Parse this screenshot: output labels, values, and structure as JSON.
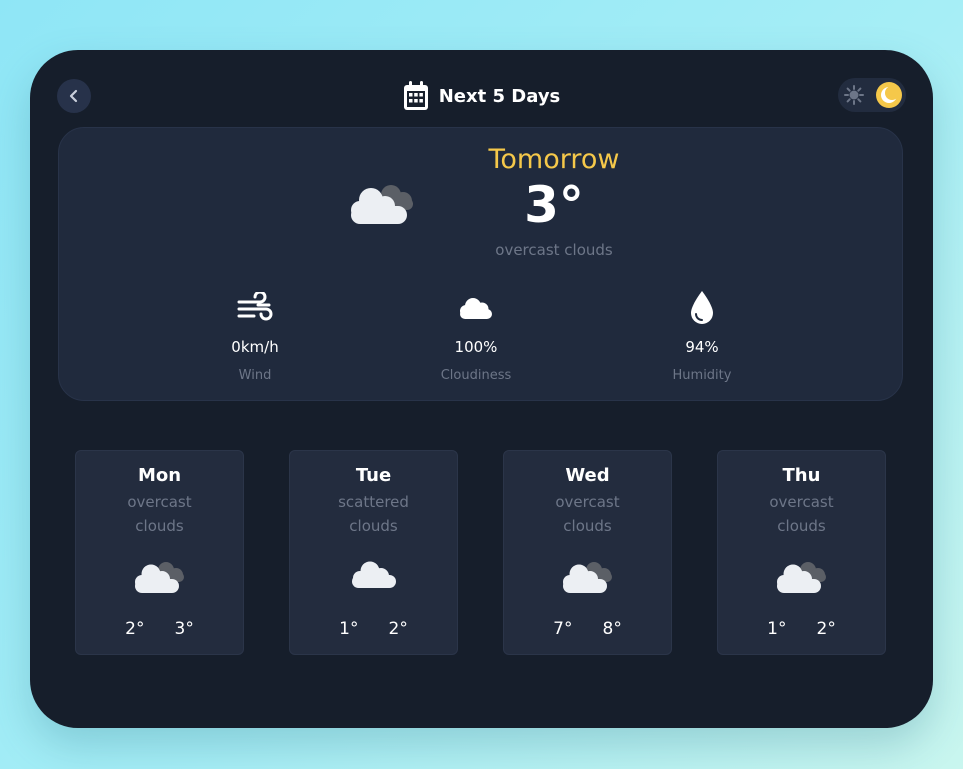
{
  "header": {
    "title": "Next 5 Days",
    "back_icon": "chevron-left-icon",
    "calendar_icon": "calendar-icon"
  },
  "theme_toggle": {
    "light_icon": "sun-icon",
    "dark_icon": "moon-icon",
    "active": "dark"
  },
  "hero": {
    "day": "Tomorrow",
    "temp": "3°",
    "description": "overcast clouds",
    "icon": "overcast-cloud-icon",
    "stats": [
      {
        "icon": "wind-icon",
        "value": "0km/h",
        "label": "Wind"
      },
      {
        "icon": "cloud-icon",
        "value": "100%",
        "label": "Cloudiness"
      },
      {
        "icon": "droplet-icon",
        "value": "94%",
        "label": "Humidity"
      }
    ]
  },
  "days": [
    {
      "name": "Mon",
      "desc_line1": "overcast",
      "desc_line2": "clouds",
      "icon": "overcast-cloud-icon",
      "min": "2°",
      "max": "3°"
    },
    {
      "name": "Tue",
      "desc_line1": "scattered",
      "desc_line2": "clouds",
      "icon": "scattered-cloud-icon",
      "min": "1°",
      "max": "2°"
    },
    {
      "name": "Wed",
      "desc_line1": "overcast",
      "desc_line2": "clouds",
      "icon": "overcast-cloud-icon",
      "min": "7°",
      "max": "8°"
    },
    {
      "name": "Thu",
      "desc_line1": "overcast",
      "desc_line2": "clouds",
      "icon": "overcast-cloud-icon",
      "min": "1°",
      "max": "2°"
    }
  ],
  "colors": {
    "accent": "#f5c84a",
    "panel": "#161e2b",
    "card": "#202a3d",
    "muted": "#6d7688"
  }
}
